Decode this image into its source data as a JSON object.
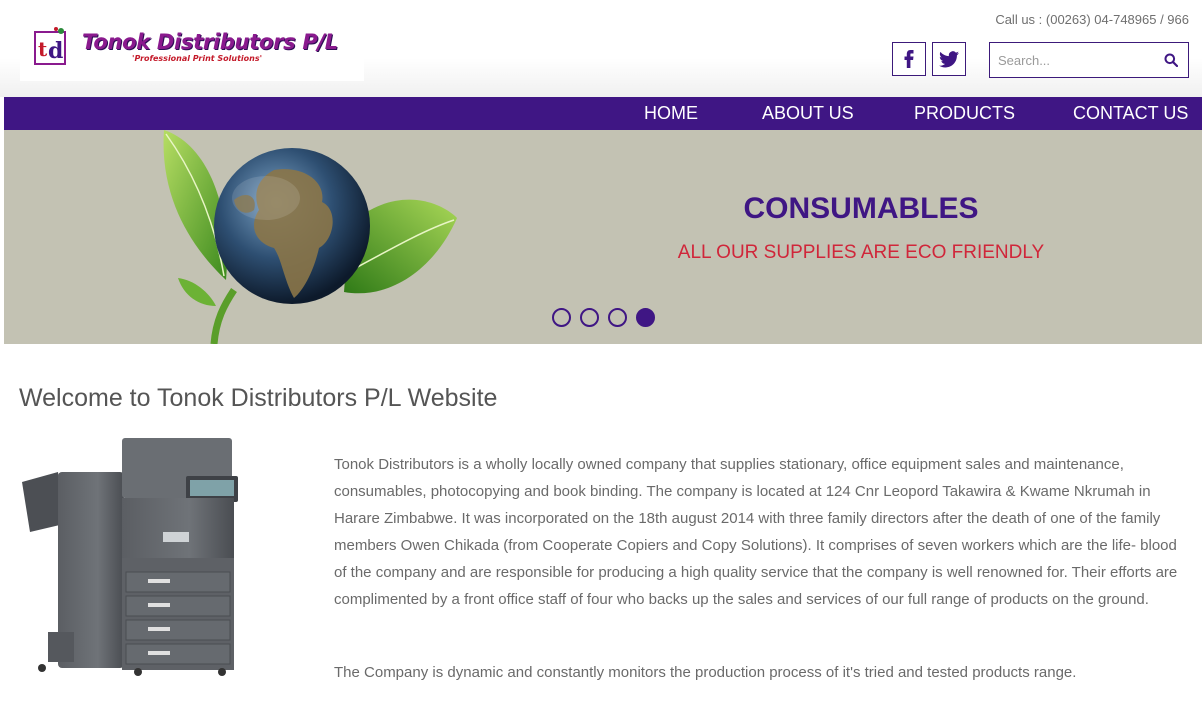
{
  "header": {
    "logo": {
      "name": "Tonok Distributors P/L",
      "tagline": "'Professional Print Solutions'"
    },
    "call_us": "Call us : (00263) 04-748965 / 966",
    "social": [
      {
        "icon": "facebook-icon",
        "glyph": "f"
      },
      {
        "icon": "twitter-icon",
        "glyph": ""
      }
    ],
    "search": {
      "placeholder": "Search...",
      "icon": "search-icon"
    }
  },
  "nav": {
    "items": [
      {
        "label": "HOME"
      },
      {
        "label": "ABOUT US"
      },
      {
        "label": "PRODUCTS"
      },
      {
        "label": "CONTACT US"
      }
    ]
  },
  "hero": {
    "title": "CONSUMABLES",
    "subtitle": "ALL OUR SUPPLIES ARE ECO FRIENDLY",
    "slides": 4,
    "active_slide": 4
  },
  "main": {
    "heading": "Welcome to Tonok Distributors P/L Website",
    "paragraphs": [
      "Tonok Distributors is a wholly locally owned company that supplies stationary, office equipment sales and maintenance, consumables, photocopying and book binding. The company is located at 124 Cnr Leopord Takawira & Kwame Nkrumah in Harare Zimbabwe. It was incorporated on the 18th august 2014 with three family directors after the death of one of the family members Owen Chikada (from Cooperate Copiers and Copy Solutions). It comprises of seven workers which are the life- blood of the company and are responsible for producing a high quality service that the company is well renowned for. Their efforts are complimented by a front office staff of four who backs up the sales and services of our full range of products on the ground.",
      "The Company is dynamic and constantly monitors the production process of it's tried and tested products range."
    ]
  },
  "colors": {
    "brand_purple": "#3f1684",
    "hero_background": "#c3c2b3",
    "hero_subtitle": "#d0263a",
    "logo_magenta": "#8a1a8e"
  }
}
